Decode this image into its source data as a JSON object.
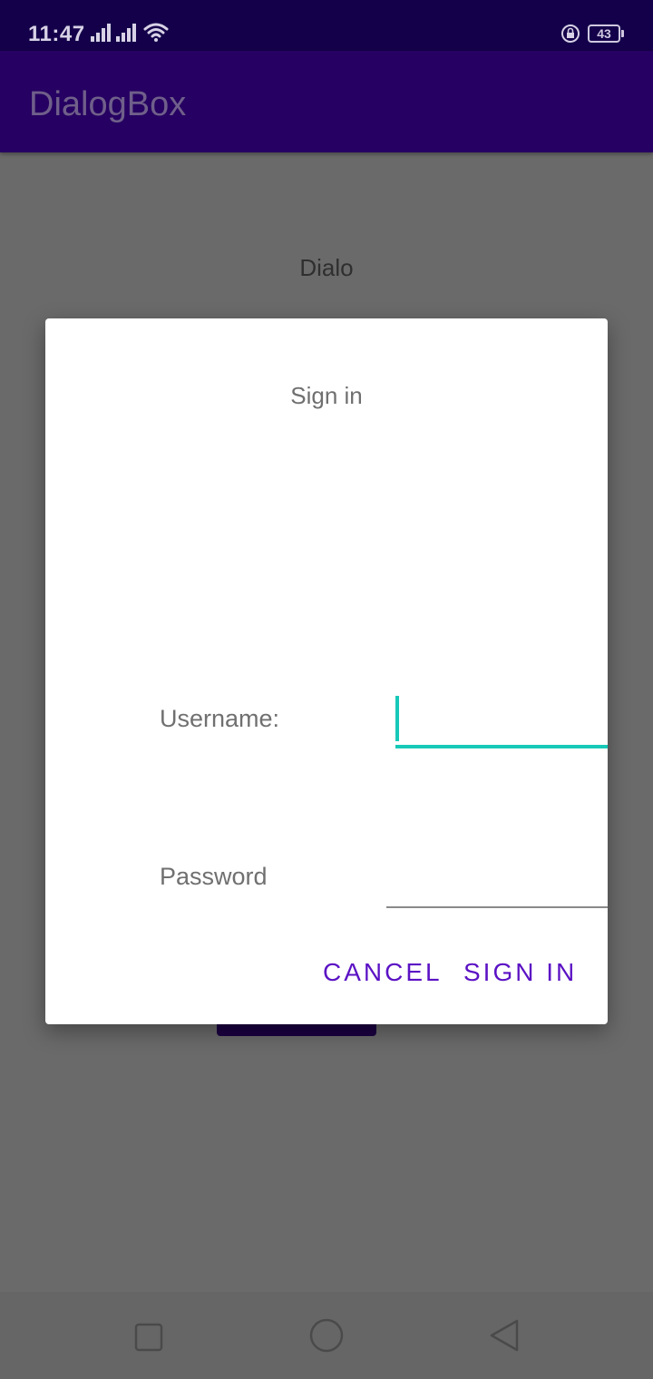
{
  "status_bar": {
    "time": "11:47",
    "battery": "43",
    "icons": [
      "signal-icon",
      "signal-icon",
      "wifi-icon",
      "rotation-lock-icon",
      "battery-icon"
    ]
  },
  "app_bar": {
    "title": "DialogBox"
  },
  "background": {
    "text": "Dialo"
  },
  "dialog": {
    "title": "Sign in",
    "username_label": "Username:",
    "username_value": "",
    "password_label": "Password",
    "password_value": "",
    "cancel_label": "CANCEL",
    "signin_label": "SIGN IN"
  },
  "nav_bar": {
    "icons": [
      "recents-icon",
      "home-icon",
      "back-icon"
    ]
  },
  "colors": {
    "status_bar": "#14004a",
    "app_bar": "#260062",
    "accent": "#17c9b8",
    "button_text": "#5b12c4",
    "scrim": "#6a6a6a"
  }
}
